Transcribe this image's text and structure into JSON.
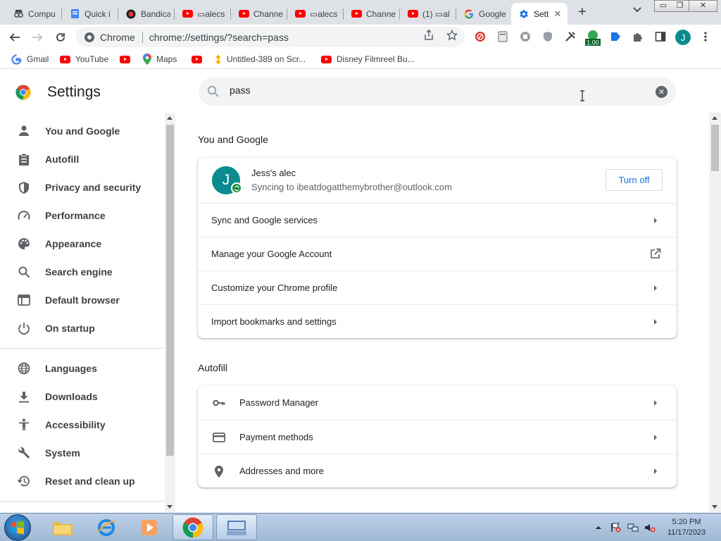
{
  "tabs": [
    {
      "title": "Compu",
      "icon": "incognito-icon"
    },
    {
      "title": "Quick i",
      "icon": "document-icon"
    },
    {
      "title": "Bandica",
      "icon": "record-icon"
    },
    {
      "title": "▭alecs",
      "icon": "youtube-icon"
    },
    {
      "title": "Channe",
      "icon": "youtube-icon"
    },
    {
      "title": "▭alecs",
      "icon": "youtube-icon"
    },
    {
      "title": "Channe",
      "icon": "youtube-icon"
    },
    {
      "title": "(1) ▭al",
      "icon": "youtube-icon"
    },
    {
      "title": "Google",
      "icon": "google-icon"
    },
    {
      "title": "Setti",
      "icon": "settings-gear-icon"
    }
  ],
  "omnibox": {
    "chip_label": "Chrome",
    "url": "chrome://settings/?search=pass"
  },
  "profile_initial": "J",
  "extensions": {
    "badge_text": "1.00"
  },
  "bookmarks": [
    {
      "label": "Gmail",
      "icon": "gmail-icon"
    },
    {
      "label": "YouTube",
      "icon": "youtube-icon"
    },
    {
      "label": "",
      "icon": "youtube-icon"
    },
    {
      "label": "Maps",
      "icon": "maps-icon"
    },
    {
      "label": "",
      "icon": "youtube-icon"
    },
    {
      "label": "Untitled-389 on Scr...",
      "icon": "screencast-icon"
    },
    {
      "label": "Disney Filmreel Bu...",
      "icon": "youtube-icon"
    }
  ],
  "settings": {
    "title": "Settings",
    "search_value": "pass"
  },
  "sidebar": {
    "items": [
      {
        "label": "You and Google",
        "icon": "person-icon"
      },
      {
        "label": "Autofill",
        "icon": "clipboard-icon"
      },
      {
        "label": "Privacy and security",
        "icon": "shield-icon"
      },
      {
        "label": "Performance",
        "icon": "speedometer-icon"
      },
      {
        "label": "Appearance",
        "icon": "palette-icon"
      },
      {
        "label": "Search engine",
        "icon": "search-icon"
      },
      {
        "label": "Default browser",
        "icon": "browser-icon"
      },
      {
        "label": "On startup",
        "icon": "power-icon"
      },
      {
        "label": "Languages",
        "icon": "globe-icon"
      },
      {
        "label": "Downloads",
        "icon": "download-icon"
      },
      {
        "label": "Accessibility",
        "icon": "accessibility-icon"
      },
      {
        "label": "System",
        "icon": "wrench-icon"
      },
      {
        "label": "Reset and clean up",
        "icon": "history-icon"
      }
    ]
  },
  "main": {
    "you_and_google": {
      "title": "You and Google",
      "account_name": "Jess's alec",
      "account_sub": "Syncing to ibeatdogatthemybrother@outlook.com",
      "avatar_initial": "J",
      "turn_off_label": "Turn off",
      "rows": [
        {
          "label": "Sync and Google services"
        },
        {
          "label": "Manage your Google Account"
        },
        {
          "label": "Customize your Chrome profile"
        },
        {
          "label": "Import bookmarks and settings"
        }
      ]
    },
    "autofill": {
      "title": "Autofill",
      "rows": [
        {
          "label": "Password Manager",
          "icon": "key-icon"
        },
        {
          "label": "Payment methods",
          "icon": "credit-card-icon"
        },
        {
          "label": "Addresses and more",
          "icon": "location-pin-icon"
        }
      ]
    }
  },
  "taskbar": {
    "time": "5:20 PM",
    "date": "11/17/2023"
  },
  "colors": {
    "accent": "#1a73e8",
    "avatar": "#0b8a8f",
    "sync_badge": "#1e8e3e",
    "youtube": "#ff0000"
  }
}
